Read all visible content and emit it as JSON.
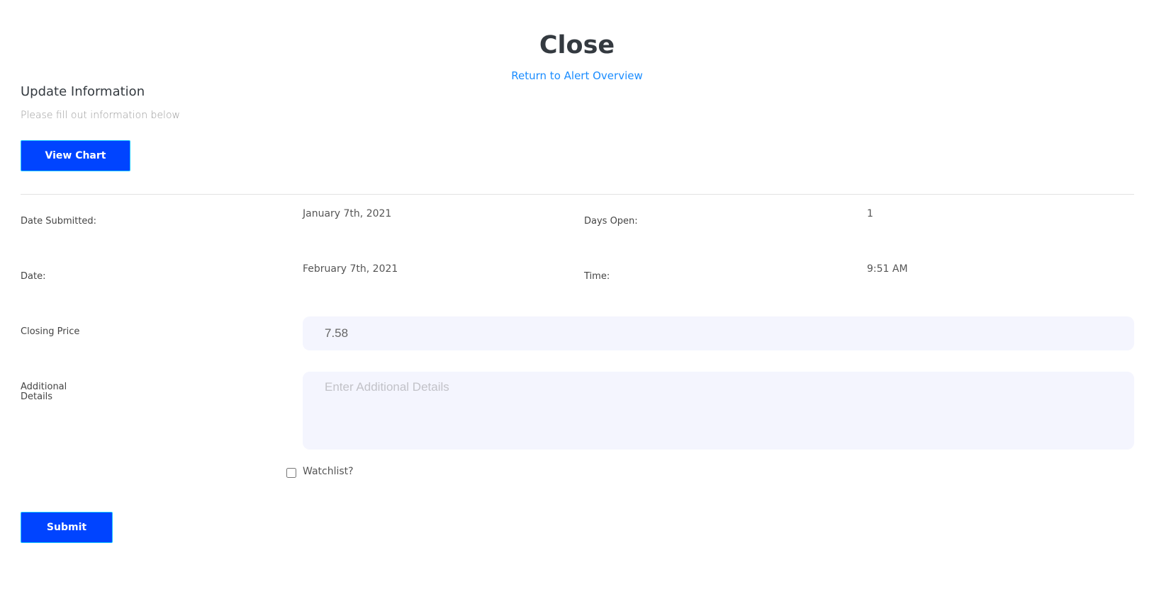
{
  "header": {
    "title": "Close",
    "return_link": "Return to Alert Overview"
  },
  "section": {
    "title": "Update Information",
    "subtitle": "Please fill out information below",
    "view_chart_label": "View Chart"
  },
  "info": {
    "date_submitted_label": "Date Submitted:",
    "date_submitted_value": "January 7th, 2021",
    "days_open_label": "Days Open:",
    "days_open_value": "1",
    "date_label": "Date:",
    "date_value": "February 7th, 2021",
    "time_label": "Time:",
    "time_value": "9:51 AM"
  },
  "form": {
    "closing_price_label": "Closing Price",
    "closing_price_value": "7.58",
    "details_label_line1": "Additional",
    "details_label_line2": "Details",
    "details_placeholder": "Enter Additional Details",
    "watchlist_label": "Watchlist?",
    "watchlist_checked": false,
    "submit_label": "Submit"
  },
  "colors": {
    "primary": "#0044ff",
    "link": "#1a8cff",
    "input_bg": "#f4f5fe"
  }
}
